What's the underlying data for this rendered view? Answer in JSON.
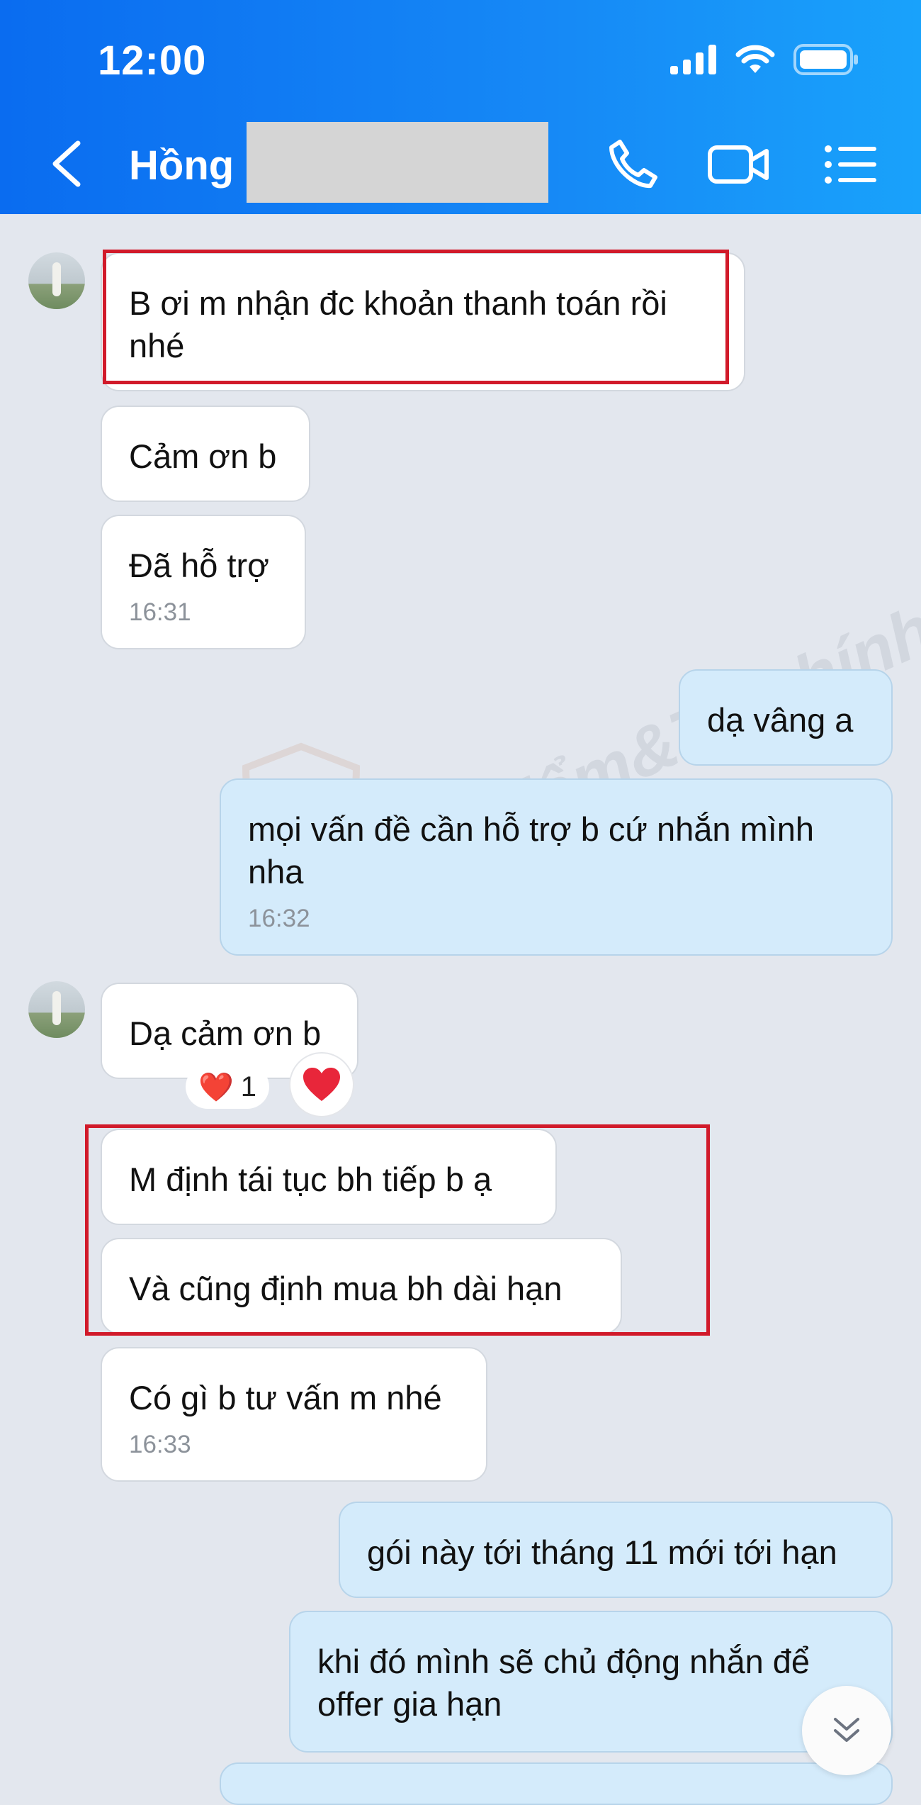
{
  "status_bar": {
    "time": "12:00"
  },
  "header": {
    "contact_name": "Hồng"
  },
  "watermark": "Bảohiểm&Tàichính",
  "messages": [
    {
      "side": "in",
      "text": "B ơi m nhận đc khoản thanh toán rồi nhé"
    },
    {
      "side": "in",
      "text": "Cảm ơn b"
    },
    {
      "side": "in",
      "text": "Đã hỗ trợ",
      "time": "16:31"
    },
    {
      "side": "out",
      "text": "dạ vâng a"
    },
    {
      "side": "out",
      "text": "mọi vấn đề cần hỗ trợ b cứ nhắn mình nha",
      "time": "16:32"
    },
    {
      "side": "in",
      "text": "Dạ cảm ơn b",
      "reaction": {
        "emoji": "❤️",
        "count": "1"
      }
    },
    {
      "side": "in",
      "text": "M định tái tục bh tiếp b ạ"
    },
    {
      "side": "in",
      "text": "Và cũng định mua bh dài hạn"
    },
    {
      "side": "in",
      "text": "Có gì b tư vấn m nhé",
      "time": "16:33"
    },
    {
      "side": "out",
      "text": "gói này tới tháng 11 mới tới hạn"
    },
    {
      "side": "out",
      "text": "khi đó mình sẽ chủ động nhắn để offer gia hạn"
    }
  ],
  "colors": {
    "header": "#1689f6",
    "incoming": "#ffffff",
    "outgoing": "#d4ebfb",
    "highlight": "#d11a2a"
  }
}
